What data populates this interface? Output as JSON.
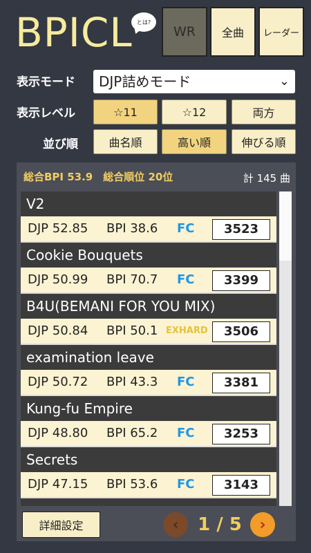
{
  "header": {
    "logo": "BPICL",
    "bubble": "とは?",
    "buttons": {
      "wr": "WR",
      "all": "全曲",
      "radar": "レーダー"
    }
  },
  "controls": {
    "display_mode_label": "表示モード",
    "display_mode_value": "DJP詰めモード",
    "display_level_label": "表示レベル",
    "levels": [
      "☆11",
      "☆12",
      "両方"
    ],
    "sort_label": "並び順",
    "sorts": [
      "曲名順",
      "高い順",
      "伸びる順"
    ]
  },
  "summary": {
    "text": "総合BPI 53.9　総合順位 20位",
    "total": "計 145 曲"
  },
  "songs": [
    {
      "title": "V2",
      "djp": "DJP 52.85",
      "bpi": "BPI 38.6",
      "lamp": "FC",
      "score": "3523"
    },
    {
      "title": "Cookie Bouquets",
      "djp": "DJP 50.99",
      "bpi": "BPI 70.7",
      "lamp": "FC",
      "score": "3399"
    },
    {
      "title": "B4U(BEMANI FOR YOU MIX)",
      "djp": "DJP 50.84",
      "bpi": "BPI 50.1",
      "lamp": "EXHARD",
      "score": "3506"
    },
    {
      "title": "examination leave",
      "djp": "DJP 50.72",
      "bpi": "BPI 43.3",
      "lamp": "FC",
      "score": "3381"
    },
    {
      "title": "Kung-fu Empire",
      "djp": "DJP 48.80",
      "bpi": "BPI 65.2",
      "lamp": "FC",
      "score": "3253"
    },
    {
      "title": "Secrets",
      "djp": "DJP 47.15",
      "bpi": "BPI 53.6",
      "lamp": "FC",
      "score": "3143"
    }
  ],
  "footer": {
    "detail_button": "詳細設定",
    "prev": "‹",
    "next": "›",
    "page_text": "1 / 5"
  },
  "colors": {
    "background": "#333842",
    "accent_yellow": "#f3cd5f",
    "fc_blue": "#2196e6",
    "exhard_yellow": "#e6c23a"
  }
}
